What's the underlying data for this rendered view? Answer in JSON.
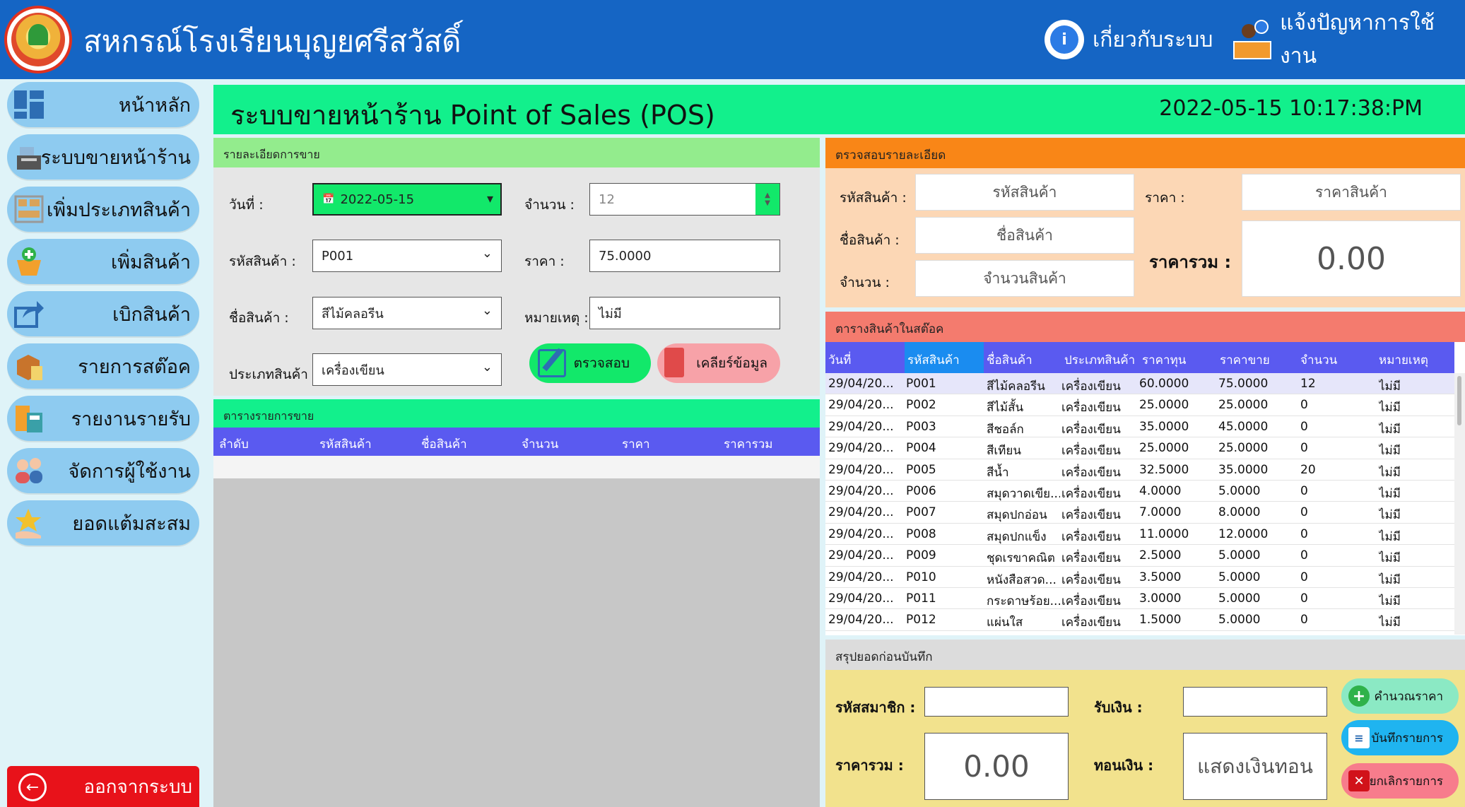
{
  "header": {
    "title": "สหกรณ์โรงเรียนบุญยศรีสวัสดิ์",
    "about": "เกี่ยวกับระบบ",
    "report_issue": "แจ้งปัญหาการใช้งาน"
  },
  "sidebar": {
    "items": [
      {
        "label": "หน้าหลัก",
        "icon": "dashboard-icon"
      },
      {
        "label": "ระบบขายหน้าร้าน",
        "icon": "cash-register-icon"
      },
      {
        "label": "เพิ่มประเภทสินค้า",
        "icon": "shelf-icon"
      },
      {
        "label": "เพิ่มสินค้า",
        "icon": "basket-add-icon"
      },
      {
        "label": "เบิกสินค้า",
        "icon": "share-icon"
      },
      {
        "label": "รายการสต๊อค",
        "icon": "box-icon"
      },
      {
        "label": "รายงานรายรับ",
        "icon": "calculator-icon"
      },
      {
        "label": "จัดการผู้ใช้งาน",
        "icon": "users-icon"
      },
      {
        "label": "ยอดแต้มสะสม",
        "icon": "star-hand-icon"
      }
    ],
    "logout": "ออกจากระบบ"
  },
  "main": {
    "title": "ระบบขายหน้าร้าน Point of Sales (POS)",
    "datetime": "2022-05-15 10:17:38:PM"
  },
  "sales_detail": {
    "heading": "รายละเอียดการขาย",
    "date_label": "วันที่ :",
    "date_value": "2022-05-15",
    "qty_label": "จำนวน :",
    "qty_value": "12",
    "code_label": "รหัสสินค้า :",
    "code_value": "P001",
    "price_label": "ราคา :",
    "price_value": "75.0000",
    "name_label": "ชื่อสินค้า :",
    "name_value": "สีไม้คลอรีน",
    "note_label": "หมายเหตุ :",
    "note_value": "ไม่มี",
    "type_label": "ประเภทสินค้า :",
    "type_value": "เครื่องเขียน",
    "check_button": "ตรวจสอบ",
    "clear_button": "เคลียร์ข้อมูล"
  },
  "sales_table": {
    "heading": "ตารางรายการขาย",
    "columns": [
      "ลำดับ",
      "รหัสสินค้า",
      "ชื่อสินค้า",
      "จำนวน",
      "ราคา",
      "ราคารวม"
    ]
  },
  "check_detail": {
    "heading": "ตรวจสอบรายละเอียด",
    "code_label": "รหัสสินค้า :",
    "code_placeholder": "รหัสสินค้า",
    "price_label": "ราคา :",
    "price_placeholder": "ราคาสินค้า",
    "name_label": "ชื่อสินค้า :",
    "name_placeholder": "ชื่อสินค้า",
    "total_label": "ราคารวม :",
    "total_value": "0.00",
    "qty_label": "จำนวน :",
    "qty_placeholder": "จำนวนสินค้า"
  },
  "stock_table": {
    "heading": "ตารางสินค้าในสต๊อค",
    "columns": [
      "วันที่",
      "รหัสสินค้า",
      "ชื่อสินค้า",
      "ประเภทสินค้า",
      "ราคาทุน",
      "ราคาขาย",
      "จำนวน",
      "หมายเหตุ"
    ],
    "rows": [
      [
        "29/04/20...",
        "P001",
        "สีไม้คลอรีน",
        "เครื่องเขียน",
        "60.0000",
        "75.0000",
        "12",
        "ไม่มี"
      ],
      [
        "29/04/20...",
        "P002",
        "สีไม้สั้น",
        "เครื่องเขียน",
        "25.0000",
        "25.0000",
        "0",
        "ไม่มี"
      ],
      [
        "29/04/20...",
        "P003",
        "สีชอล์ก",
        "เครื่องเขียน",
        "35.0000",
        "45.0000",
        "0",
        "ไม่มี"
      ],
      [
        "29/04/20...",
        "P004",
        "สีเทียน",
        "เครื่องเขียน",
        "25.0000",
        "25.0000",
        "0",
        "ไม่มี"
      ],
      [
        "29/04/20...",
        "P005",
        "สีน้ำ",
        "เครื่องเขียน",
        "32.5000",
        "35.0000",
        "20",
        "ไม่มี"
      ],
      [
        "29/04/20...",
        "P006",
        "สมุดวาดเขีย...",
        "เครื่องเขียน",
        "4.0000",
        "5.0000",
        "0",
        "ไม่มี"
      ],
      [
        "29/04/20...",
        "P007",
        "สมุดปกอ่อน",
        "เครื่องเขียน",
        "7.0000",
        "8.0000",
        "0",
        "ไม่มี"
      ],
      [
        "29/04/20...",
        "P008",
        "สมุดปกแข็ง",
        "เครื่องเขียน",
        "11.0000",
        "12.0000",
        "0",
        "ไม่มี"
      ],
      [
        "29/04/20...",
        "P009",
        "ชุดเรขาคณิต",
        "เครื่องเขียน",
        "2.5000",
        "5.0000",
        "0",
        "ไม่มี"
      ],
      [
        "29/04/20...",
        "P010",
        "หนังสือสวด...",
        "เครื่องเขียน",
        "3.5000",
        "5.0000",
        "0",
        "ไม่มี"
      ],
      [
        "29/04/20...",
        "P011",
        "กระดาษร้อย...",
        "เครื่องเขียน",
        "3.0000",
        "5.0000",
        "0",
        "ไม่มี"
      ],
      [
        "29/04/20...",
        "P012",
        "แผ่นใส",
        "เครื่องเขียน",
        "1.5000",
        "5.0000",
        "0",
        "ไม่มี"
      ]
    ]
  },
  "summary": {
    "heading": "สรุปยอดก่อนบันทึก",
    "member_label": "รหัสสมาชิก :",
    "receive_label": "รับเงิน :",
    "total_label": "ราคารวม :",
    "total_value": "0.00",
    "change_label": "ทอนเงิน :",
    "change_placeholder": "แสดงเงินทอน",
    "calc_button": "คำนวณราคา",
    "save_button": "บันทึกรายการ",
    "cancel_button": "ยกเลิกรายการ"
  }
}
